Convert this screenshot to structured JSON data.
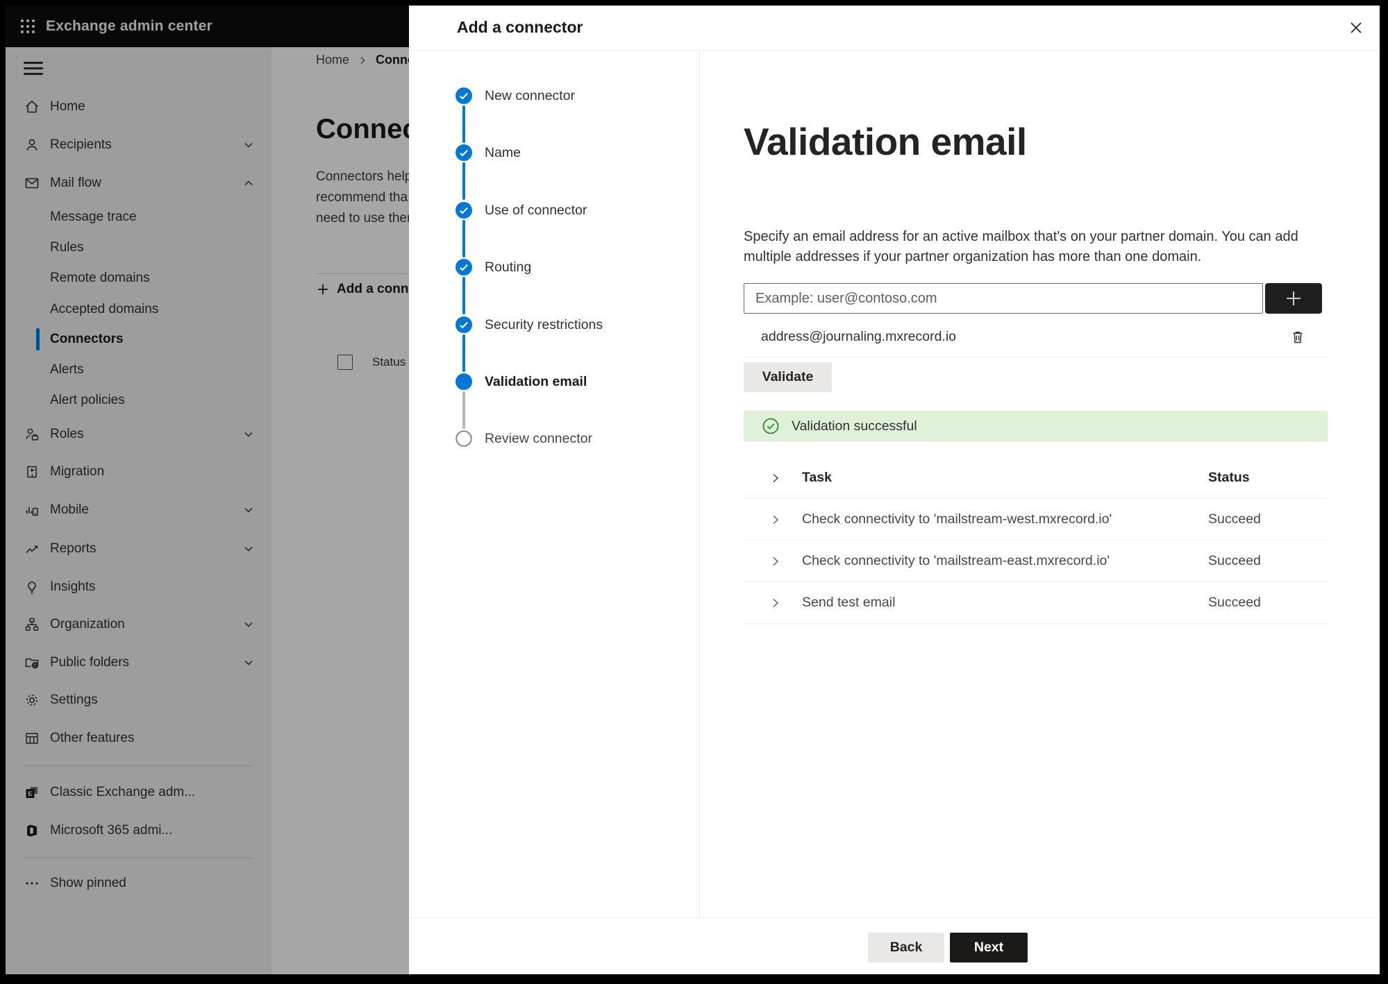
{
  "topbar": {
    "title": "Exchange admin center"
  },
  "sidebar": {
    "items": [
      {
        "label": "Home"
      },
      {
        "label": "Recipients"
      },
      {
        "label": "Mail flow"
      },
      {
        "label": "Message trace"
      },
      {
        "label": "Rules"
      },
      {
        "label": "Remote domains"
      },
      {
        "label": "Accepted domains"
      },
      {
        "label": "Connectors"
      },
      {
        "label": "Alerts"
      },
      {
        "label": "Alert policies"
      },
      {
        "label": "Roles"
      },
      {
        "label": "Migration"
      },
      {
        "label": "Mobile"
      },
      {
        "label": "Reports"
      },
      {
        "label": "Insights"
      },
      {
        "label": "Organization"
      },
      {
        "label": "Public folders"
      },
      {
        "label": "Settings"
      },
      {
        "label": "Other features"
      },
      {
        "label": "Classic Exchange adm..."
      },
      {
        "label": "Microsoft 365 admi..."
      },
      {
        "label": "Show pinned"
      }
    ]
  },
  "page": {
    "breadcrumb": {
      "home": "Home",
      "current": "Conne"
    },
    "title": "Connect",
    "intro_lines": {
      "l1": "Connectors help",
      "l2": "recommend tha",
      "l3": "need to use ther"
    },
    "add_button": "Add a conn",
    "status_header": "Status"
  },
  "dialog": {
    "title": "Add a connector",
    "steps": [
      {
        "label": "New connector",
        "state": "done"
      },
      {
        "label": "Name",
        "state": "done"
      },
      {
        "label": "Use of connector",
        "state": "done"
      },
      {
        "label": "Routing",
        "state": "done"
      },
      {
        "label": "Security restrictions",
        "state": "done"
      },
      {
        "label": "Validation email",
        "state": "current"
      },
      {
        "label": "Review connector",
        "state": "upcoming"
      }
    ],
    "content": {
      "heading": "Validation email",
      "description": "Specify an email address for an active mailbox that's on your partner domain. You can add multiple addresses if your partner organization has more than one domain.",
      "email_input": {
        "placeholder": "Example: user@contoso.com",
        "value": ""
      },
      "added_address": "address@journaling.mxrecord.io",
      "validate_button": "Validate",
      "success_message": "Validation successful",
      "results_table": {
        "columns": [
          "Task",
          "Status"
        ],
        "rows": [
          {
            "task": "Check connectivity to 'mailstream-west.mxrecord.io'",
            "status": "Succeed"
          },
          {
            "task": "Check connectivity to 'mailstream-east.mxrecord.io'",
            "status": "Succeed"
          },
          {
            "task": "Send test email",
            "status": "Succeed"
          }
        ]
      }
    },
    "footer": {
      "back": "Back",
      "next": "Next"
    }
  },
  "colors": {
    "accent": "#0078d4",
    "success_green": "#2e8a2e",
    "success_bg": "#dff1d9",
    "dark_button": "#1b1a19"
  }
}
